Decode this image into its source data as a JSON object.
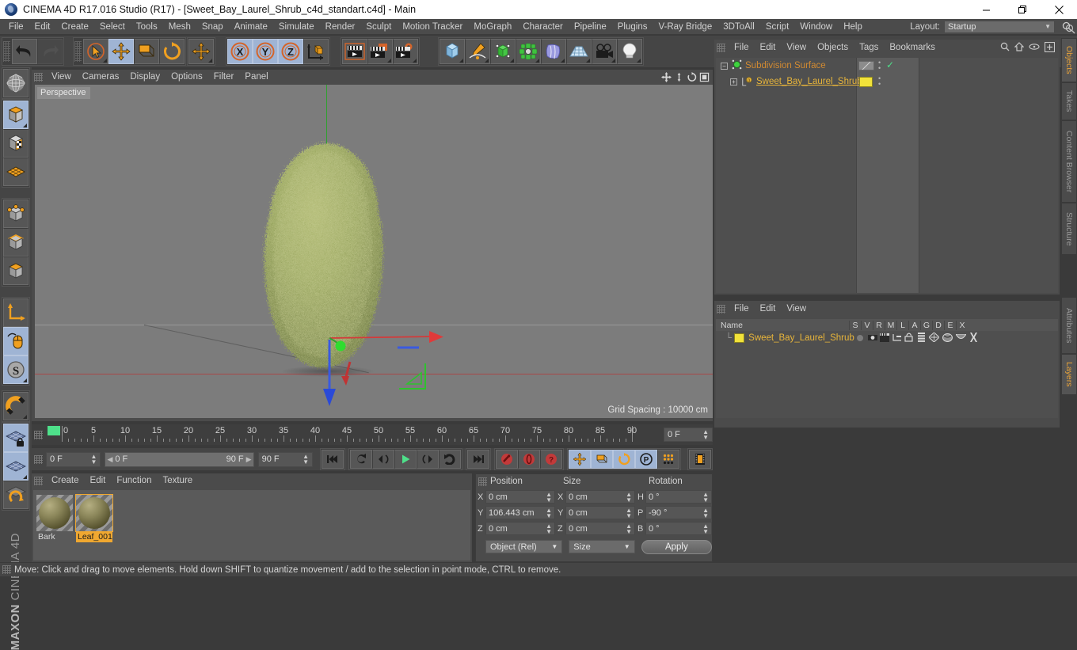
{
  "window": {
    "title": "CINEMA 4D R17.016 Studio (R17) - [Sweet_Bay_Laurel_Shrub_c4d_standart.c4d] - Main",
    "app_icon": "cinema4d-logo-icon",
    "minimize": "minimize-icon",
    "maximize": "restore-icon",
    "close": "close-icon"
  },
  "menubar": {
    "items": [
      {
        "label": "File"
      },
      {
        "label": "Edit"
      },
      {
        "label": "Create"
      },
      {
        "label": "Select"
      },
      {
        "label": "Tools"
      },
      {
        "label": "Mesh"
      },
      {
        "label": "Snap"
      },
      {
        "label": "Animate"
      },
      {
        "label": "Simulate"
      },
      {
        "label": "Render"
      },
      {
        "label": "Sculpt"
      },
      {
        "label": "Motion Tracker"
      },
      {
        "label": "MoGraph"
      },
      {
        "label": "Character"
      },
      {
        "label": "Pipeline"
      },
      {
        "label": "Plugins"
      },
      {
        "label": "V-Ray Bridge"
      },
      {
        "label": "3DToAll"
      },
      {
        "label": "Script"
      },
      {
        "label": "Window"
      },
      {
        "label": "Help"
      }
    ],
    "layout_label": "Layout:",
    "layout_value": "Startup",
    "search_icon": "search-icon"
  },
  "toolbar": {
    "undo": "Undo",
    "redo": "Redo",
    "live_selection": "Live Selection",
    "move": "Move",
    "scale": "Scale",
    "rotate": "Rotate",
    "move_alt": "Move",
    "axis_x": "X",
    "axis_y": "Y",
    "axis_z": "Z",
    "world_object": "World / Object Coordinate System",
    "render_view": "Render View",
    "render_region": "Render to Picture Viewer",
    "render_settings": "Edit Render Settings",
    "cube": "Cube",
    "spline_pen": "Pen",
    "subdivision": "Subdivision Surface",
    "mograph": "MoGraph",
    "deformer": "Bend",
    "scene": "Floor",
    "camera": "Camera",
    "light": "Light"
  },
  "lefttools": {
    "items": [
      {
        "name": "make-editable",
        "label": "Make Editable"
      },
      {
        "name": "model-mode",
        "label": "Model Mode",
        "active": true
      },
      {
        "name": "texture-mode",
        "label": "Texture Mode"
      },
      {
        "name": "uv-mode",
        "label": "UV Polygons"
      },
      {
        "name": "point-mode",
        "label": "Points"
      },
      {
        "name": "edge-mode",
        "label": "Edges"
      },
      {
        "name": "polygon-mode",
        "label": "Polygons"
      },
      {
        "name": "axis-mode",
        "label": "Enable Axis Modification"
      },
      {
        "name": "viewport-solo",
        "label": "Viewport Solo",
        "active": true
      },
      {
        "name": "snap-settings",
        "label": "Enable Snapping",
        "active": true
      },
      {
        "name": "magnet",
        "label": "Magnet"
      },
      {
        "name": "workplane-lock",
        "label": "Lock Workplane",
        "active": true
      },
      {
        "name": "workplane",
        "label": "Workplane"
      }
    ],
    "brand_top": "MAXON",
    "brand_bottom": "CINEMA 4D"
  },
  "viewport": {
    "menu": [
      "View",
      "Cameras",
      "Display",
      "Options",
      "Filter",
      "Panel"
    ],
    "label": "Perspective",
    "grid_spacing": "Grid Spacing : 10000 cm",
    "axis_x": "X",
    "axis_y": "Y",
    "axis_z": "Z",
    "object_in_scene": "Sweet_Bay_Laurel_Shrub",
    "nav_icons": [
      "move-view-icon",
      "pan-view-icon",
      "rotate-view-icon",
      "maximize-view-icon"
    ]
  },
  "timeline": {
    "ticks": [
      0,
      5,
      10,
      15,
      20,
      25,
      30,
      35,
      40,
      45,
      50,
      55,
      60,
      65,
      70,
      75,
      80,
      85,
      90
    ],
    "current_frame": "0 F",
    "range_start": "0 F",
    "range_end": "90 F",
    "preview_min": "0 F",
    "preview_max": "90 F",
    "max_frame": "90 F"
  },
  "transport": {
    "buttons": [
      {
        "name": "go-to-start-button",
        "glyph": "start"
      },
      {
        "name": "play-backwards-button",
        "glyph": "revplay"
      },
      {
        "name": "previous-frame-button",
        "glyph": "prev"
      },
      {
        "name": "play-button",
        "glyph": "play"
      },
      {
        "name": "next-frame-button",
        "glyph": "next"
      },
      {
        "name": "loop-button",
        "glyph": "loop"
      },
      {
        "name": "go-to-end-button",
        "glyph": "end"
      }
    ],
    "key_buttons": [
      {
        "name": "record-keyframe-button"
      },
      {
        "name": "autokeying-button"
      },
      {
        "name": "keyframe-selection-button"
      }
    ],
    "key_toggles": [
      {
        "name": "position-key-toggle",
        "active": true
      },
      {
        "name": "scale-key-toggle",
        "active": true
      },
      {
        "name": "rotation-key-toggle",
        "active": true
      },
      {
        "name": "parameter-key-toggle",
        "active": true
      },
      {
        "name": "point-level-animation-toggle",
        "active": false
      }
    ],
    "timeline_button": "timeline-icon"
  },
  "materials": {
    "menu": [
      "Create",
      "Edit",
      "Function",
      "Texture"
    ],
    "items": [
      {
        "name": "Bark",
        "selected": false
      },
      {
        "name": "Leaf_001",
        "selected": true
      }
    ]
  },
  "coordinates": {
    "col_position": "Position",
    "col_size": "Size",
    "col_rotation": "Rotation",
    "rows": [
      {
        "plab": "X",
        "pval": "0 cm",
        "slab": "X",
        "sval": "0 cm",
        "rlab": "H",
        "rval": "0 °"
      },
      {
        "plab": "Y",
        "pval": "106.443 cm",
        "slab": "Y",
        "sval": "0 cm",
        "rlab": "P",
        "rval": "-90 °"
      },
      {
        "plab": "Z",
        "pval": "0 cm",
        "slab": "Z",
        "sval": "0 cm",
        "rlab": "B",
        "rval": "0 °"
      }
    ],
    "mode_dropdown": "Object (Rel)",
    "size_dropdown": "Size",
    "apply_button": "Apply"
  },
  "object_manager": {
    "menu": [
      "File",
      "Edit",
      "View",
      "Objects",
      "Tags",
      "Bookmarks"
    ],
    "icons": [
      "search-icon",
      "home-icon",
      "eye-icon",
      "add-layer-icon"
    ],
    "rows": [
      {
        "label": "Subdivision Surface",
        "color": "#d18a32",
        "icon": "subdivision-surface-icon",
        "tag_type": "display-tag",
        "check": "✓",
        "depth": 0
      },
      {
        "label": "Sweet_Bay_Laurel_Shrub",
        "color": "#e8b53a",
        "icon": "polygon-object-icon",
        "tag_type": "material-tag",
        "check": "",
        "depth": 1
      }
    ]
  },
  "layer_manager": {
    "menu": [
      "File",
      "Edit",
      "View"
    ],
    "name_header": "Name",
    "columns": [
      "S",
      "V",
      "R",
      "M",
      "L",
      "A",
      "G",
      "D",
      "E",
      "X"
    ],
    "rows": [
      {
        "label": "Sweet_Bay_Laurel_Shrub",
        "swatch": "#f1e23a"
      }
    ]
  },
  "right_tabs": {
    "top": [
      {
        "label": "Objects",
        "active": true
      },
      {
        "label": "Takes",
        "active": false
      },
      {
        "label": "Content Browser",
        "active": false
      },
      {
        "label": "Structure",
        "active": false
      }
    ],
    "bottom": [
      {
        "label": "Attributes",
        "active": false
      },
      {
        "label": "Layers",
        "active": true
      }
    ]
  },
  "statusbar": {
    "text": "Move: Click and drag to move elements. Hold down SHIFT to quantize movement / add to the selection in point mode, CTRL to remove."
  },
  "colors": {
    "accent_orange": "#e8a33a",
    "panel_bg": "#4b4b4b",
    "toolbar_bg": "#454545",
    "viewport_bg": "#7c7c7c",
    "axis_x": "#e03a3a",
    "axis_y": "#3ec93e",
    "axis_z": "#3a5ae0",
    "selection_blue": "#9fb4d4"
  }
}
